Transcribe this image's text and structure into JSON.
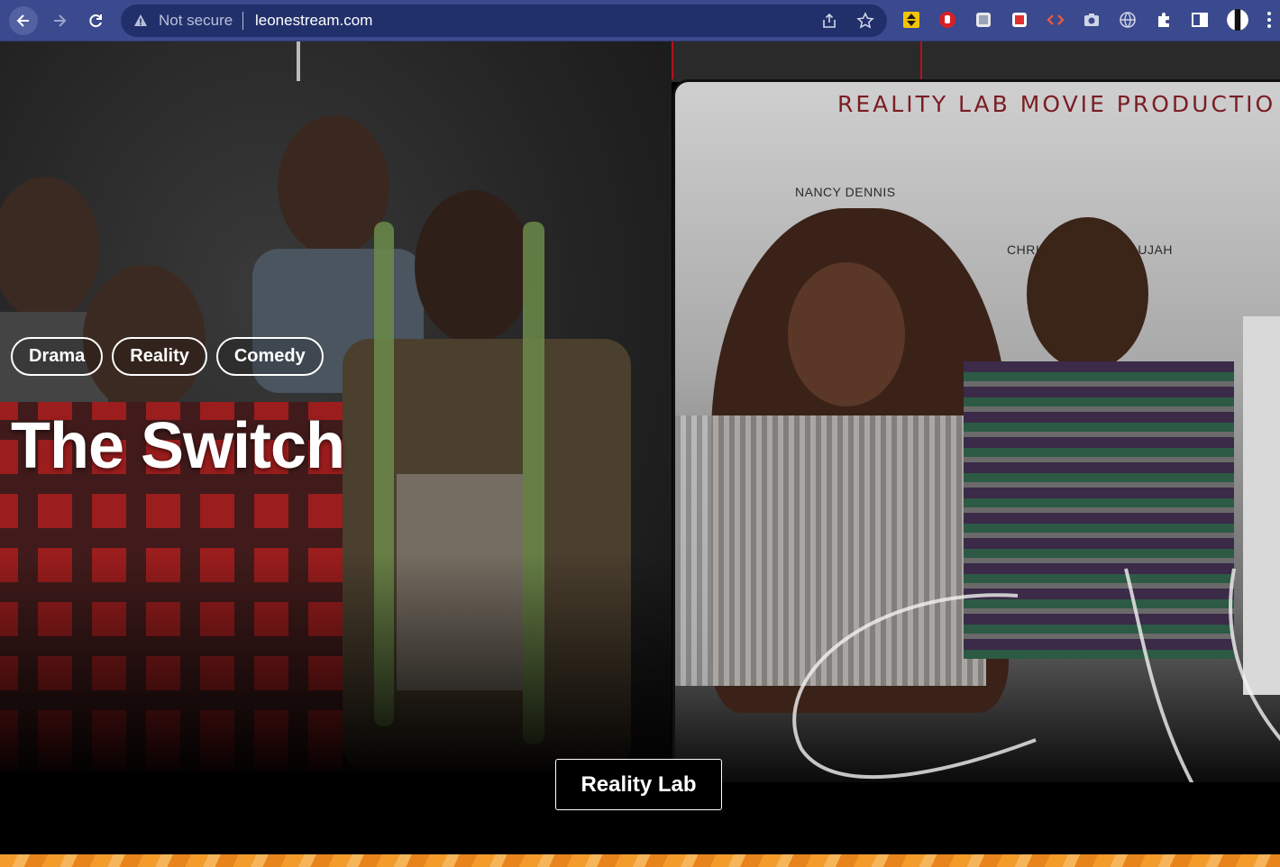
{
  "browser": {
    "security_label": "Not secure",
    "url": "leonestream.com",
    "extensions": [
      "arrows-extension-icon",
      "stop-hand-icon",
      "document-scan-icon",
      "pdf-icon",
      "code-brackets-icon",
      "camera-icon",
      "globe-icon",
      "puzzle-icon",
      "sidebar-icon",
      "profile-avatar-icon",
      "kebab-menu-icon"
    ]
  },
  "hero": {
    "genres": [
      "Drama",
      "Reality",
      "Comedy"
    ],
    "title": "The Switch",
    "studio_button": "Reality Lab"
  },
  "poster": {
    "studio_text": "REALITY LAB MOVIE PRODUCTIO",
    "actor_left": "NANCY DENNIS",
    "actor_right": "CHRISPIN AIAH NGAUJAH"
  },
  "colors": {
    "chrome": "#3b4a8e",
    "omnibox": "#21306b",
    "accent_orange": "#f39c2c",
    "poster_red": "#7a1d24"
  }
}
